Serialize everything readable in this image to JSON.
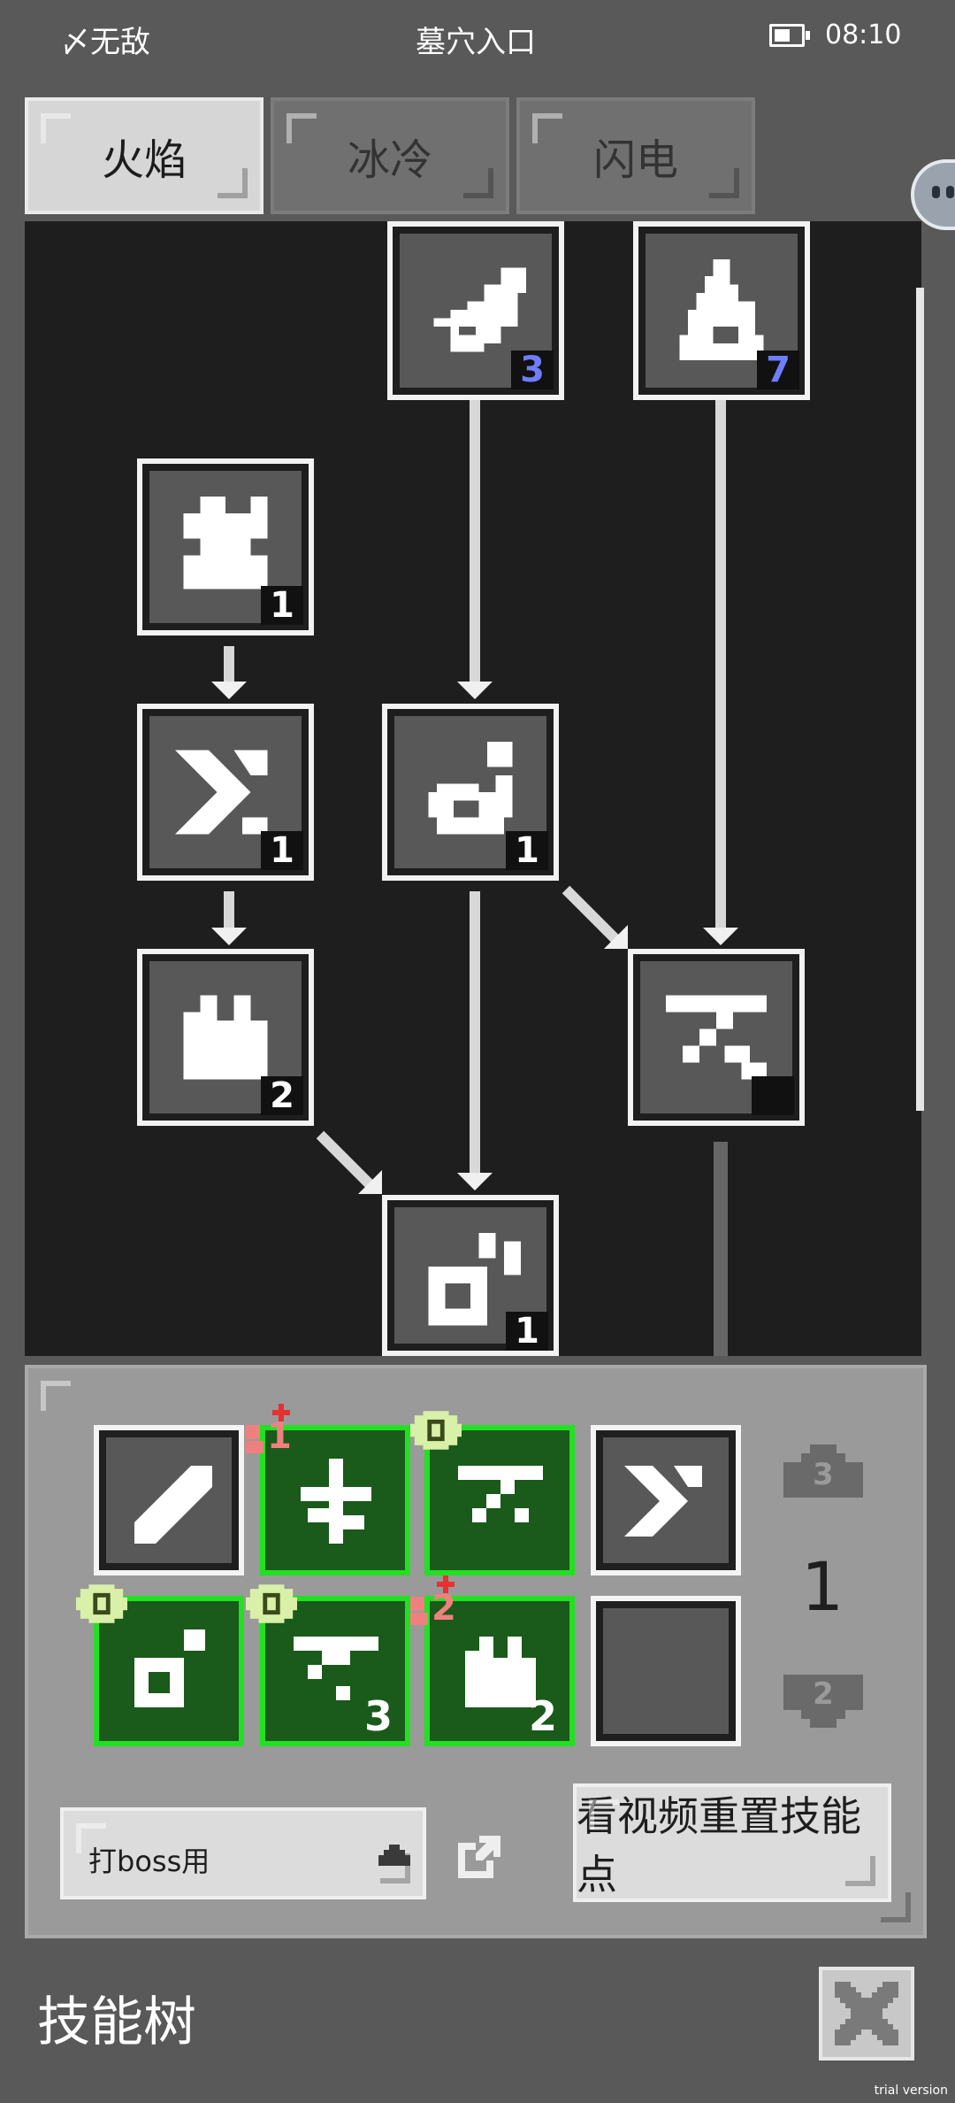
{
  "status_bar": {
    "carrier": "〆无敌",
    "location": "墓穴入口",
    "time": "08:10",
    "battery_level": 0.6
  },
  "tabs": [
    {
      "label": "火焰",
      "active": true
    },
    {
      "label": "冰冷",
      "active": false
    },
    {
      "label": "闪电",
      "active": false
    }
  ],
  "skill_tree": {
    "nodes": [
      {
        "id": "fire-comet",
        "level": "3",
        "maxed": true
      },
      {
        "id": "fire-pillar",
        "level": "7",
        "maxed": true
      },
      {
        "id": "fire-burst",
        "level": "1",
        "maxed": false
      },
      {
        "id": "fire-dash",
        "level": "1",
        "maxed": false
      },
      {
        "id": "fire-meteor",
        "level": "1",
        "maxed": false
      },
      {
        "id": "fire-storm",
        "level": "2",
        "maxed": false
      },
      {
        "id": "fire-tornado",
        "level": "",
        "maxed": false
      },
      {
        "id": "fire-spiral",
        "level": "1",
        "maxed": false
      }
    ]
  },
  "loadout": {
    "slots": [
      {
        "id": "slot-1",
        "equipped": false,
        "level": ""
      },
      {
        "id": "slot-2",
        "equipped": true,
        "level": "",
        "upgrade": "1"
      },
      {
        "id": "slot-3",
        "equipped": true,
        "level": "",
        "eye_badge": true
      },
      {
        "id": "slot-4",
        "equipped": false,
        "level": ""
      },
      {
        "id": "slot-5",
        "equipped": true,
        "level": "",
        "eye_badge": true
      },
      {
        "id": "slot-6",
        "equipped": true,
        "level": "3",
        "eye_badge": true
      },
      {
        "id": "slot-7",
        "equipped": true,
        "level": "2",
        "upgrade": "2"
      },
      {
        "id": "slot-8",
        "equipped": false,
        "level": ""
      }
    ],
    "page": "1",
    "page_up": "3",
    "page_down": "2"
  },
  "preset_select": {
    "value": "打boss用"
  },
  "reset_button": {
    "label": "看视频重置技能点"
  },
  "footer": {
    "title": "技能树"
  },
  "watermark": "trial version",
  "colors": {
    "equipped_border": "#22e022",
    "maxed_level": "#6f7dff",
    "upgrade_badge": "#e85a5a"
  }
}
